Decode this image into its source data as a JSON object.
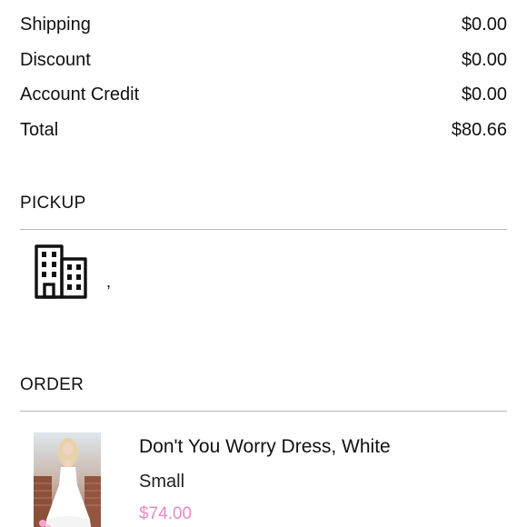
{
  "summary": {
    "rows": [
      {
        "label": "Shipping",
        "value": "$0.00"
      },
      {
        "label": "Discount",
        "value": "$0.00"
      },
      {
        "label": "Account Credit",
        "value": "$0.00"
      },
      {
        "label": "Total",
        "value": "$80.66"
      }
    ]
  },
  "pickup": {
    "title": "PICKUP",
    "icon": "building-icon",
    "address": ","
  },
  "order": {
    "title": "ORDER",
    "items": [
      {
        "name": "Don't You Worry Dress, White",
        "variant": "Small",
        "price": "$74.00"
      }
    ]
  },
  "colors": {
    "price": "#e58bc6",
    "divider": "#b8b8b8"
  }
}
